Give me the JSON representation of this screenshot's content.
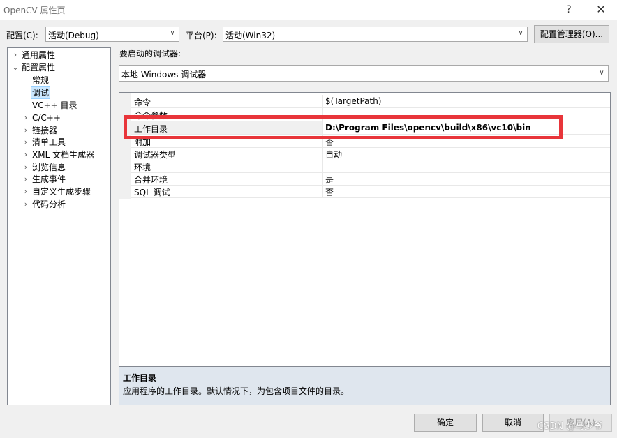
{
  "window": {
    "title": "OpenCV 属性页",
    "help": "?",
    "close": "✕"
  },
  "toolbar": {
    "config_label": "配置(C):",
    "config_value": "活动(Debug)",
    "platform_label": "平台(P):",
    "platform_value": "活动(Win32)",
    "config_manager": "配置管理器(O)..."
  },
  "tree": {
    "items": [
      {
        "label": "通用属性",
        "expander": "›"
      },
      {
        "label": "配置属性",
        "expander": "⌄"
      },
      {
        "label": "常规",
        "expander": ""
      },
      {
        "label": "调试",
        "expander": ""
      },
      {
        "label": "VC++ 目录",
        "expander": ""
      },
      {
        "label": "C/C++",
        "expander": "›"
      },
      {
        "label": "链接器",
        "expander": "›"
      },
      {
        "label": "清单工具",
        "expander": "›"
      },
      {
        "label": "XML 文档生成器",
        "expander": "›"
      },
      {
        "label": "浏览信息",
        "expander": "›"
      },
      {
        "label": "生成事件",
        "expander": "›"
      },
      {
        "label": "自定义生成步骤",
        "expander": "›"
      },
      {
        "label": "代码分析",
        "expander": "›"
      }
    ]
  },
  "main": {
    "debugger_label": "要启动的调试器:",
    "debugger_value": "本地 Windows 调试器",
    "properties": [
      {
        "name": "命令",
        "value": "$(TargetPath)"
      },
      {
        "name": "命令参数",
        "value": ""
      },
      {
        "name": "工作目录",
        "value": "D:\\Program Files\\opencv\\build\\x86\\vc10\\bin"
      },
      {
        "name": "附加",
        "value": "否"
      },
      {
        "name": "调试器类型",
        "value": "自动"
      },
      {
        "name": "环境",
        "value": ""
      },
      {
        "name": "合并环境",
        "value": "是"
      },
      {
        "name": "SQL 调试",
        "value": "否"
      }
    ],
    "description": {
      "title": "工作目录",
      "text": "应用程序的工作目录。默认情况下，为包含项目文件的目录。"
    }
  },
  "buttons": {
    "ok": "确定",
    "cancel": "取消",
    "apply": "应用(A)"
  },
  "watermark": "CSDN @马少爷",
  "colors": {
    "highlight_box": "#e8353a",
    "selection": "#cce8ff",
    "description_bg": "#dfe6ee"
  }
}
